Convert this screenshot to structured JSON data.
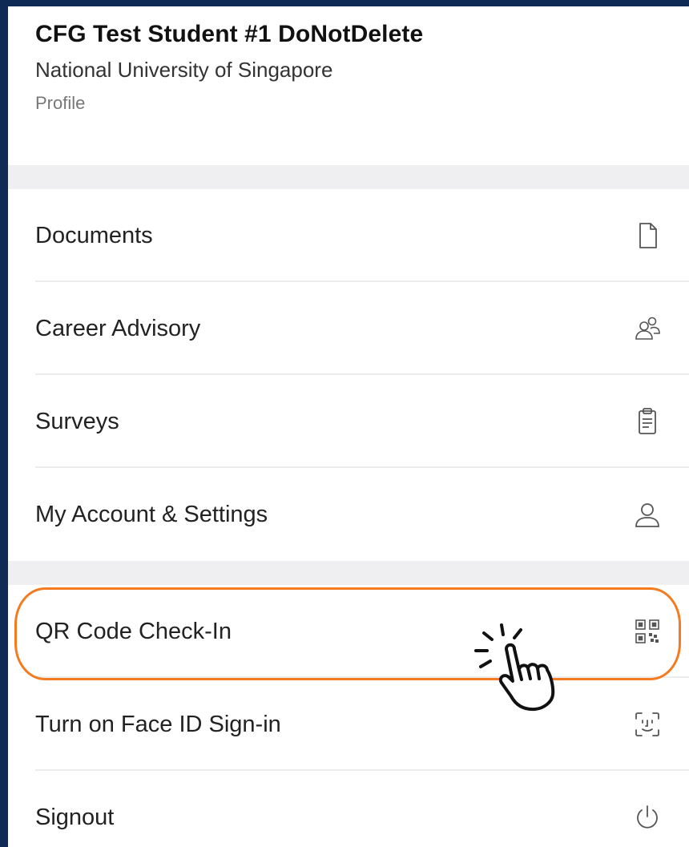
{
  "profile": {
    "name": "CFG Test Student #1 DoNotDelete",
    "organization": "National University of Singapore",
    "link": "Profile"
  },
  "menu": {
    "items": [
      {
        "label": "Documents",
        "icon": "document-icon"
      },
      {
        "label": "Career Advisory",
        "icon": "people-icon"
      },
      {
        "label": "Surveys",
        "icon": "clipboard-icon"
      },
      {
        "label": "My Account & Settings",
        "icon": "person-icon"
      },
      {
        "label": "QR Code Check-In",
        "icon": "qr-code-icon"
      },
      {
        "label": "Turn on Face ID Sign-in",
        "icon": "face-id-icon"
      },
      {
        "label": "Signout",
        "icon": "power-icon"
      }
    ]
  },
  "colors": {
    "highlight": "#f47b20",
    "background": "#0f2a55",
    "section_gap": "#efeff2"
  }
}
